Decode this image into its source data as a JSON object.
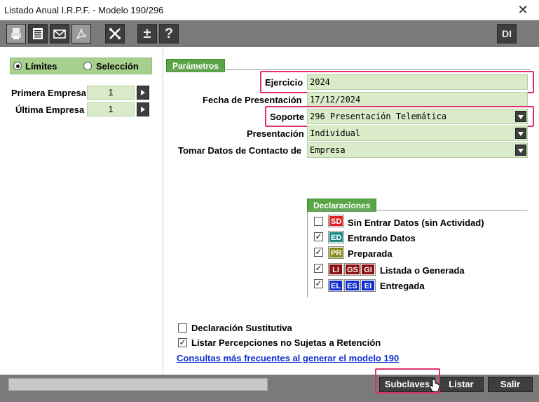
{
  "window": {
    "title": "Listado Anual I.R.P.F. - Modelo 190/296",
    "close_glyph": "✕"
  },
  "toolbar": {
    "buttons": [
      {
        "icon": "printer-icon"
      },
      {
        "icon": "list-icon"
      },
      {
        "icon": "mail-icon"
      },
      {
        "icon": "pdf-icon"
      },
      {
        "icon": "tools-icon"
      },
      {
        "icon": "plus-minus-icon",
        "glyph": "±"
      },
      {
        "icon": "help-icon",
        "glyph": "?"
      },
      {
        "icon": "di-icon",
        "glyph": "DI"
      }
    ]
  },
  "left": {
    "radio_limits": "Límites",
    "radio_selection": "Selección",
    "selected": "Límites",
    "first_company_label": "Primera Empresa",
    "first_company_value": "1",
    "last_company_label": "Última Empresa",
    "last_company_value": "1"
  },
  "params": {
    "tab_label": "Parámetros",
    "ejercicio_label": "Ejercicio",
    "ejercicio_value": "2024",
    "fecha_label": "Fecha de Presentación",
    "fecha_value": "17/12/2024",
    "soporte_label": "Soporte",
    "soporte_value": "296 Presentación Telemática",
    "presentacion_label": "Presentación",
    "presentacion_value": "Individual",
    "contacto_label": "Tomar Datos de Contacto de",
    "contacto_value": "Empresa"
  },
  "declaraciones": {
    "tab_label": "Declaraciones",
    "items": [
      {
        "label": "Sin Entrar Datos (sin Actividad)",
        "checked": false,
        "badges": [
          "SD"
        ]
      },
      {
        "label": "Entrando Datos",
        "checked": true,
        "badges": [
          "ED"
        ]
      },
      {
        "label": "Preparada",
        "checked": true,
        "badges": [
          "PR"
        ]
      },
      {
        "label": "Listada o Generada",
        "checked": true,
        "badges": [
          "LI",
          "GS",
          "GI"
        ]
      },
      {
        "label": "Entregada",
        "checked": true,
        "badges": [
          "EL",
          "ES",
          "EI"
        ]
      }
    ],
    "colors": {
      "SD": "#e02020",
      "ED": "#1a8a8a",
      "PR": "#8a8a10",
      "LI": "#8a1010",
      "GS": "#8a1010",
      "GI": "#8a1010",
      "EL": "#1030d0",
      "ES": "#1030d0",
      "EI": "#1030d0"
    }
  },
  "options": {
    "sustitutiva_label": "Declaración Sustitutiva",
    "sustitutiva_checked": false,
    "percepciones_label": "Listar Percepciones no Sujetas a Retención",
    "percepciones_checked": true,
    "link_text": "Consultas más frecuentes al generar el modelo 190"
  },
  "footer": {
    "subclaves_label": "Subclaves",
    "listar_label": "Listar",
    "salir_label": "Salir"
  },
  "colors": {
    "highlight": "#e0306a",
    "field_bg": "#d9ebc9",
    "tab_green": "#5aa646"
  }
}
